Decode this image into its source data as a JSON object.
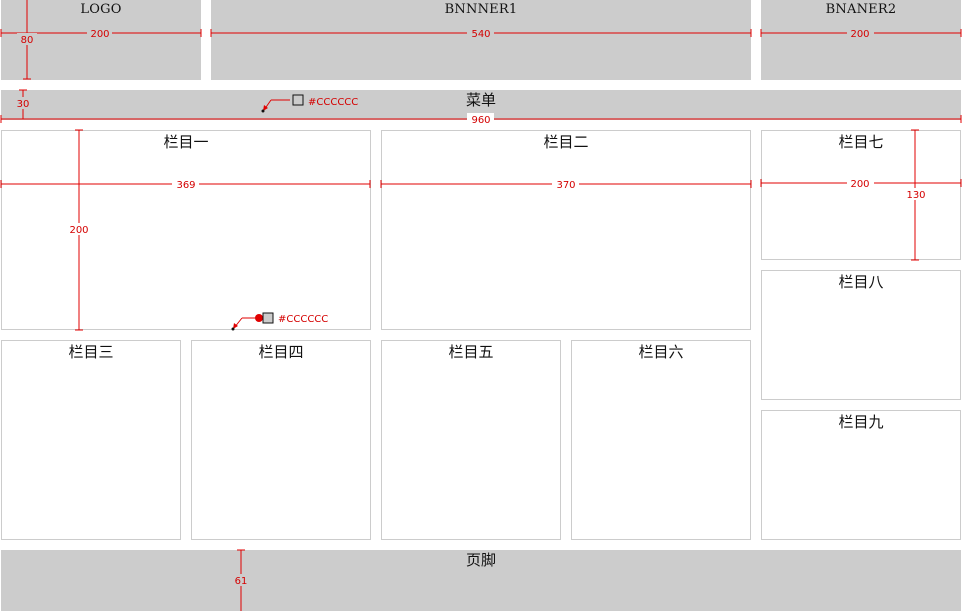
{
  "header": {
    "logo": "LOGO",
    "banner1": "BNNNER1",
    "banner2": "BNANER2"
  },
  "menu": {
    "label": "菜单"
  },
  "sections": {
    "one": "栏目一",
    "two": "栏目二",
    "three": "栏目三",
    "four": "栏目四",
    "five": "栏目五",
    "six": "栏目六",
    "seven": "栏目七",
    "eight": "栏目八",
    "nine": "栏目九"
  },
  "footer": {
    "label": "页脚"
  },
  "measurements": {
    "header_height": "80",
    "logo_width": "200",
    "banner1_width": "540",
    "banner2_width": "200",
    "menu_height": "30",
    "page_width": "960",
    "section_one_width": "369",
    "section_one_height": "200",
    "section_two_width": "370",
    "section_seven_width": "200",
    "section_seven_height": "130",
    "footer_height": "61"
  },
  "color_notes": {
    "menu_color": "#CCCCCC",
    "border_color": "#CCCCCC"
  },
  "colors": {
    "block_gray": "#cccccc",
    "annotation_red": "#e00000"
  }
}
